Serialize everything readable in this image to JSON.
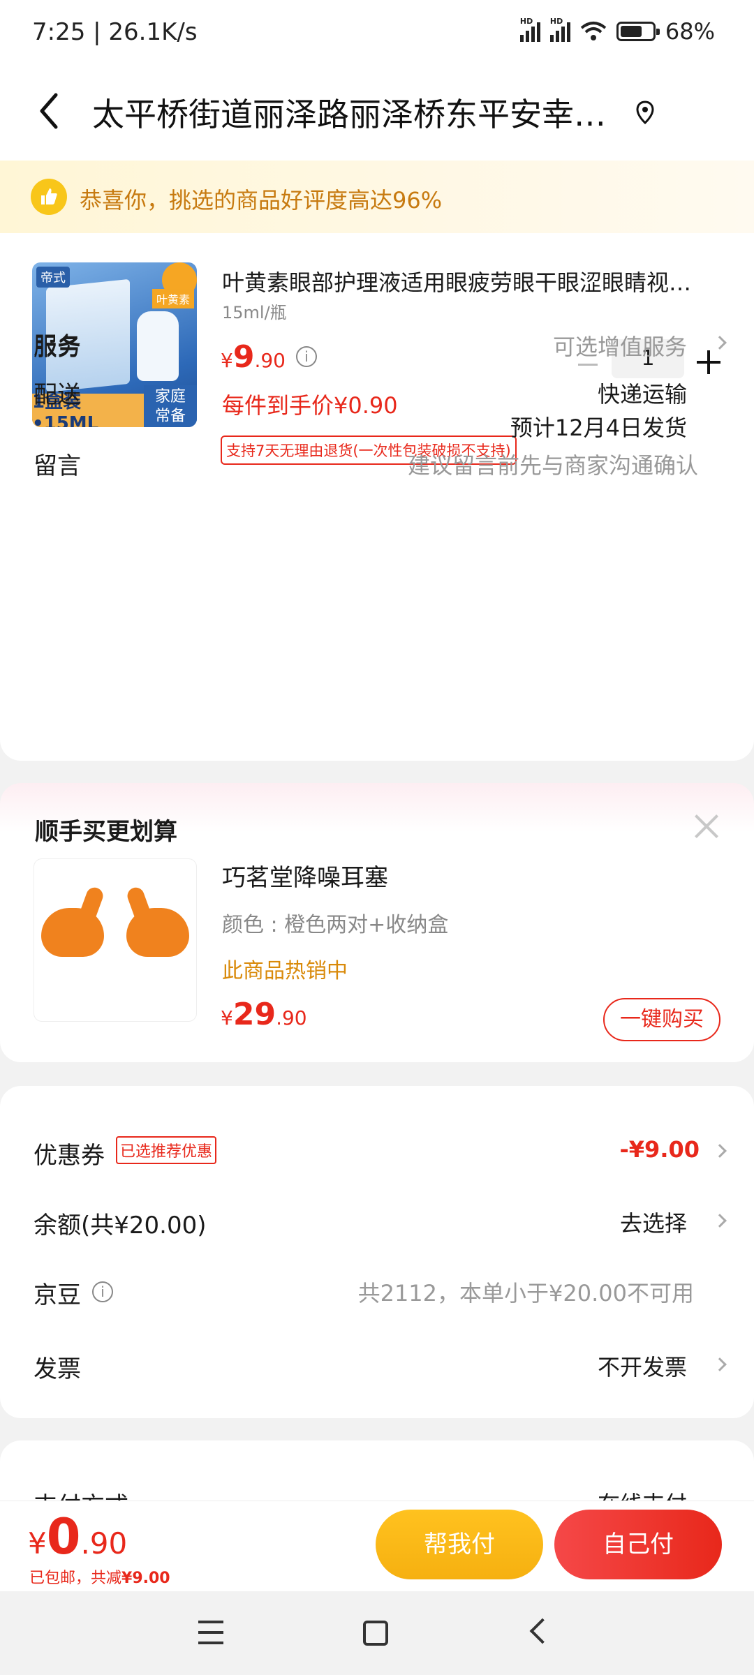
{
  "status": {
    "time": "7:25 | 26.1K/s",
    "battery": "68%",
    "hd1": "HD",
    "hd2": "HD"
  },
  "header": {
    "title": "太平桥街道丽泽路丽泽桥东平安幸…"
  },
  "banner": {
    "text": "恭喜你，挑选的商品好评度高达96%"
  },
  "product": {
    "image_brand": "帝式",
    "image_tag": "叶黄素",
    "image_band": "1盒装•15ML",
    "image_family_1": "家庭",
    "image_family_2": "常备",
    "name": "叶黄素眼部护理液适用眼疲劳眼干眼涩眼睛视…",
    "spec": "15ml/瓶",
    "price_symbol": "¥",
    "price_int": "9",
    "price_dec": ".90",
    "each_price": "每件到手价¥0.90",
    "return_policy": "支持7天无理由退货(一次性包装破损不支持)",
    "quantity": "1"
  },
  "rows": {
    "service_label": "服务",
    "service_value": "可选增值服务",
    "delivery_label": "配送",
    "delivery_value1": "快递运输",
    "delivery_value2": "预计12月4日发货",
    "message_label": "留言",
    "message_placeholder": "建议留言前先与商家沟通确认"
  },
  "upsell": {
    "title": "顺手买更划算",
    "name": "巧茗堂降噪耳塞",
    "color": "颜色 : 橙色两对+收纳盒",
    "hot": "此商品热销中",
    "price_symbol": "¥",
    "price_int": "29",
    "price_dec": ".90",
    "buy_label": "一键购买"
  },
  "payment": {
    "coupon_label": "优惠券",
    "coupon_badge": "已选推荐优惠",
    "coupon_value": "-¥9.00",
    "balance_label": "余额(共¥20.00)",
    "balance_value": "去选择",
    "jd_label": "京豆",
    "jd_value": "共2112，本单小于¥20.00不可用",
    "invoice_label": "发票",
    "invoice_value": "不开发票",
    "method_label": "支付方式",
    "method_value": "在线支付"
  },
  "bottom": {
    "price_symbol": "¥",
    "price_int": "0",
    "price_dec": ".90",
    "note_prefix": "已包邮，共减",
    "note_amount": "¥9.00",
    "help_pay": "帮我付",
    "self_pay": "自己付"
  },
  "colors": {
    "accent": "#e8281b",
    "yellow": "#f6b010",
    "banner_text": "#c77a10"
  }
}
